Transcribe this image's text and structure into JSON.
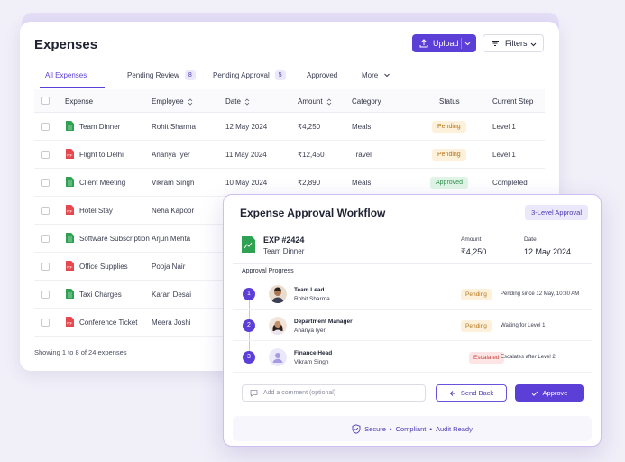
{
  "colors": {
    "accent": "#5b3fd6",
    "pending": "#b7741a",
    "approved": "#2f8f4e",
    "escalated": "#c9463d",
    "pdf": "#e5484d",
    "file": "#2fa152"
  },
  "card": {
    "title": "Expenses",
    "upload_label": "Upload",
    "filters_label": "Filters",
    "tabs": [
      {
        "label": "All Expenses",
        "count": ""
      },
      {
        "label": "Pending Review",
        "count": "8"
      },
      {
        "label": "Pending Approval",
        "count": "5"
      },
      {
        "label": "Approved",
        "count": ""
      },
      {
        "label": "More",
        "count": ""
      }
    ],
    "columns": [
      "Expense",
      "Employee",
      "Date",
      "Amount",
      "Category",
      "Status",
      "Current Step"
    ],
    "rows": [
      {
        "icon": "sheet-icon",
        "expense": "Team Dinner",
        "employee": "Rohit Sharma",
        "date": "12 May 2024",
        "amount": "₹4,250",
        "category": "Meals",
        "status": "Pending",
        "step": "Level 1"
      },
      {
        "icon": "pdf-icon",
        "expense": "Flight to Delhi",
        "employee": "Ananya Iyer",
        "date": "11 May 2024",
        "amount": "₹12,450",
        "category": "Travel",
        "status": "Pending",
        "step": "Level 1"
      },
      {
        "icon": "sheet-icon",
        "expense": "Client Meeting",
        "employee": "Vikram Singh",
        "date": "10 May 2024",
        "amount": "₹2,890",
        "category": "Meals",
        "status": "Approved",
        "step": "Completed"
      },
      {
        "icon": "pdf-icon",
        "expense": "Hotel Stay",
        "employee": "Neha Kapoor"
      },
      {
        "icon": "sheet-icon",
        "expense": "Software Subscription",
        "employee": "Arjun Mehta"
      },
      {
        "icon": "pdf-icon",
        "expense": "Office Supplies",
        "employee": "Pooja Nair"
      },
      {
        "icon": "sheet-icon",
        "expense": "Taxi Charges",
        "employee": "Karan Desai"
      },
      {
        "icon": "pdf-icon",
        "expense": "Conference Ticket",
        "employee": "Meera Joshi"
      }
    ],
    "footer": "Showing 1 to 8 of 24 expenses"
  },
  "workflow": {
    "title": "Expense Approval Workflow",
    "badge": "3-Level Approval",
    "exp_id": "EXP #2424",
    "exp_name": "Team Dinner",
    "amount_label": "Amount",
    "amount": "₹4,250",
    "date_label": "Date",
    "date": "12 May 2024",
    "progress_label": "Approval Progress",
    "steps": [
      {
        "num": "1",
        "role": "Team Lead",
        "person": "Rohit Sharma",
        "status": "Pending",
        "note": "Pending since 12 May, 10:30 AM"
      },
      {
        "num": "2",
        "role": "Department Manager",
        "person": "Ananya Iyer",
        "status": "Pending",
        "note": "Waiting for Level 1"
      },
      {
        "num": "3",
        "role": "Finance Head",
        "person": "Vikram Singh",
        "status": "Escalated",
        "note": "Escalates after Level 2"
      }
    ],
    "comment_placeholder": "Add a comment (optional)",
    "send_back_label": "Send Back",
    "approve_label": "Approve",
    "footer_items": [
      "Secure",
      "•",
      "Compliant",
      "•",
      "Audit Ready"
    ]
  }
}
